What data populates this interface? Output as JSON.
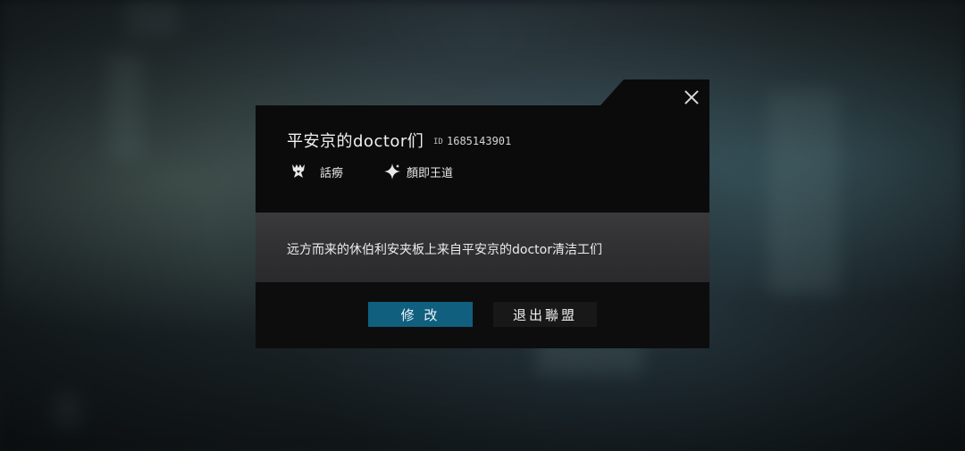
{
  "dialog": {
    "title": "平安京的doctor们",
    "id_label": "ID",
    "id_value": "1685143901",
    "tags": [
      {
        "icon": "clan-crest-icon",
        "label": "話癆"
      },
      {
        "icon": "sparkle-star-icon",
        "label": "顏即王道"
      }
    ],
    "description": "远方而来的休伯利安夹板上来自平安京的doctor清洁工们",
    "buttons": {
      "edit": "修 改",
      "quit": "退出聯盟"
    },
    "close_icon": "close-icon"
  },
  "colors": {
    "accent": "#105f7e",
    "panel": "#0b0b0c",
    "mid_panel": "#333335"
  }
}
